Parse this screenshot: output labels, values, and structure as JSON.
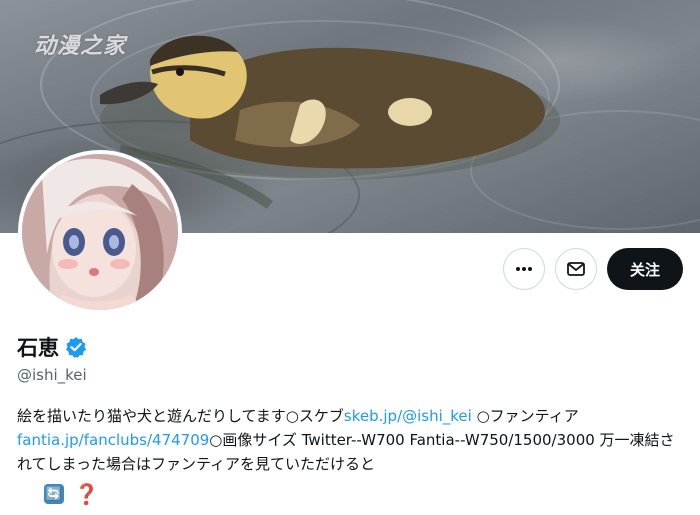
{
  "banner": {
    "watermark": "动漫之家"
  },
  "profile": {
    "display_name": "石恵",
    "handle": "@ishi_kei",
    "verified": true,
    "accent_color": "#1d9bf0"
  },
  "actions": {
    "more_icon": "more-horizontal-icon",
    "message_icon": "envelope-icon",
    "follow_label": "关注"
  },
  "bio": {
    "segment1": "絵を描いたり猫や犬と遊んだりしてます○スケブ",
    "link1": "skeb.jp/@ishi_kei",
    "segment2": " ○ファンティア",
    "link2": "fantia.jp/fanclubs/474709",
    "segment3": "○画像サイズ Twitter--W700 Fantia--W750/1500/3000 万一凍結されてしまった場合はファンティアを見ていただけると",
    "emoji1": "🔄",
    "emoji2": "❓"
  }
}
